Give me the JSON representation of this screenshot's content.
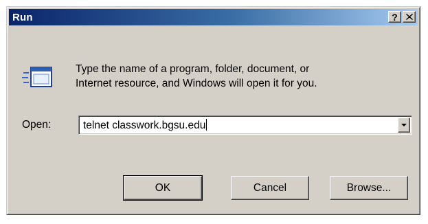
{
  "window": {
    "title": "Run",
    "help_label": "?",
    "close_label": "✕"
  },
  "content": {
    "description_line1": "Type the name of a program, folder, document, or",
    "description_line2": "Internet resource, and Windows will open it for you.",
    "open_label": "Open:",
    "open_value": "telnet classwork.bgsu.edu"
  },
  "buttons": {
    "ok": "OK",
    "cancel": "Cancel",
    "browse": "Browse..."
  },
  "icons": {
    "run": "run-program-icon",
    "dropdown": "chevron-down-icon"
  },
  "colors": {
    "titlebar_start": "#0a246a",
    "titlebar_end": "#a6caf0",
    "face": "#d4d0c8"
  }
}
